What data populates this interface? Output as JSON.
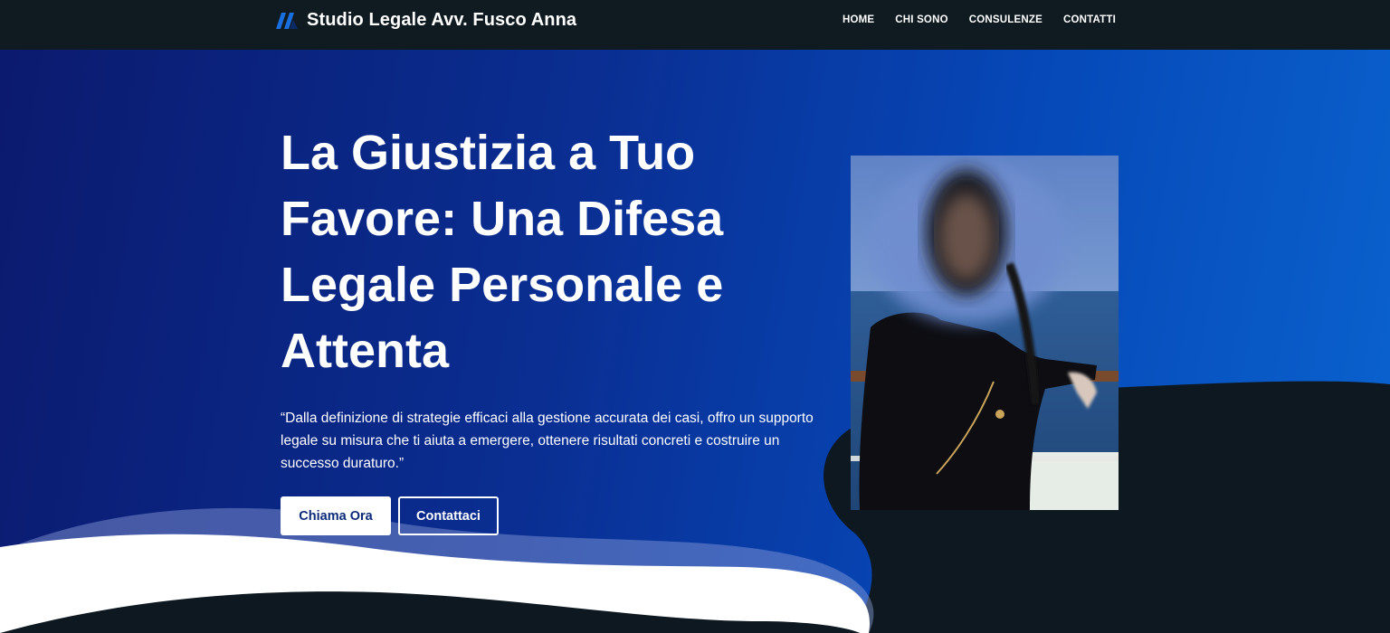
{
  "header": {
    "brand": "Studio Legale Avv. Fusco Anna",
    "logo_icon": "brand-logo-icon",
    "menu": [
      "HOME",
      "CHI SONO",
      "CONSULENZE",
      "CONTATTI"
    ]
  },
  "hero": {
    "title": "La Giustizia a Tuo Favore: Una Difesa Legale Personale e Attenta",
    "quote": "“Dalla definizione di strategie efficaci alla gestione accurata dei casi, offro un supporto legale su misura che ti aiuta a emergere, ottenere risultati concreti e costruire un successo duraturo.”",
    "buttons": {
      "primary": "Chiama Ora",
      "secondary": "Contattaci"
    }
  },
  "colors": {
    "nav_bg": "#0f1a21",
    "hero_gradient_start": "#0b1a6e",
    "hero_gradient_end": "#0a63cf",
    "dark_wave": "#0d1820",
    "button_text": "#0b2a7a"
  }
}
